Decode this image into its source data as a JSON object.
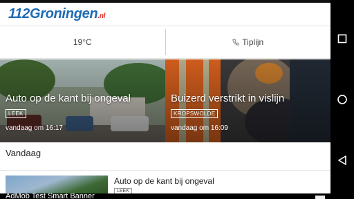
{
  "app": {
    "logo": {
      "text": "112Groningen",
      "suffix": ".nl"
    },
    "weather": "19°C",
    "tip_label": "Tiplijn"
  },
  "hero": [
    {
      "title": "Auto op de kant bij ongeval",
      "tag": "LEEK",
      "date": "vandaag om 16:17"
    },
    {
      "title": "Buizerd verstrikt in vislijn",
      "tag": "KROPSWOLDE",
      "date": "vandaag om 16:09"
    }
  ],
  "section": {
    "title": "Vandaag"
  },
  "list": [
    {
      "title": "Auto op de kant bij ongeval",
      "tag": "LEEK"
    }
  ],
  "ad": {
    "text": "AdMob Test Smart Banner"
  },
  "colors": {
    "brand_blue": "#1d6bb3",
    "brand_red": "#d9261c"
  },
  "icons": [
    "phone-icon",
    "recents-icon",
    "home-icon",
    "back-icon"
  ]
}
